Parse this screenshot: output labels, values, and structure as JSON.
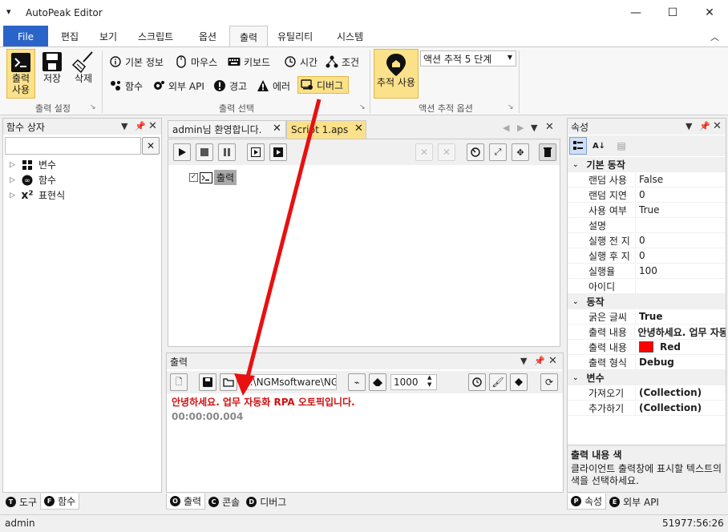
{
  "window": {
    "title": "AutoPeak Editor",
    "status_left": "admin",
    "status_right": "51977:56:26"
  },
  "menu_tabs": [
    "File",
    "편집",
    "보기",
    "스크립트",
    "옵션",
    "출력",
    "유틸리티",
    "시스템"
  ],
  "ribbon": {
    "output_group": {
      "btn_output": "출력\n사용",
      "btn_save": "저장",
      "btn_delete": "삭제",
      "label": "출력 설정"
    },
    "select_group": {
      "items": [
        "기본 정보",
        "마우스",
        "키보드",
        "시간",
        "조건",
        "함수",
        "외부 API",
        "경고",
        "에러",
        "디버그"
      ],
      "label": "출력 선택"
    },
    "trace_group": {
      "btn_trace": "추적 사용",
      "dropdown": "액션 추적 5 단계",
      "label": "액션 추적 옵션"
    }
  },
  "left_panel": {
    "title": "함수 상자",
    "tree": [
      "변수",
      "함수",
      "표현식"
    ],
    "bottom_tabs": [
      {
        "key": "T",
        "label": "도구"
      },
      {
        "key": "F",
        "label": "함수"
      }
    ]
  },
  "doc_tabs": [
    "admin님 환영합니다.",
    "Script 1.aps"
  ],
  "script_tree": {
    "node": "출력"
  },
  "output_panel": {
    "title": "출력",
    "path": "E:\\NGMsoftware\\NG",
    "count": "1000",
    "message": "안녕하세요. 업무 자동화 RPA 오토픽입니다.",
    "time": "00:00:00.004",
    "bottom_tabs": [
      {
        "key": "O",
        "label": "출력"
      },
      {
        "key": "C",
        "label": "콘솔"
      },
      {
        "key": "D",
        "label": "디버그"
      }
    ]
  },
  "props_panel": {
    "title": "속성",
    "categories": [
      {
        "name": "기본 동작",
        "rows": [
          [
            "랜덤 사용",
            "False"
          ],
          [
            "랜덤 지연",
            "0"
          ],
          [
            "사용 여부",
            "True"
          ],
          [
            "설명",
            ""
          ],
          [
            "실행 전 지",
            "0"
          ],
          [
            "실행 후 지",
            "0"
          ],
          [
            "실행율",
            "100"
          ],
          [
            "아이디",
            ""
          ]
        ]
      },
      {
        "name": "동작",
        "rows": [
          [
            "굵은 글씨",
            "True"
          ],
          [
            "출력 내용",
            "안녕하세요. 업무 자동"
          ],
          [
            "출력 내용",
            "Red"
          ],
          [
            "출력 형식",
            "Debug"
          ]
        ]
      },
      {
        "name": "변수",
        "rows": [
          [
            "가져오기",
            "(Collection)"
          ],
          [
            "추가하기",
            "(Collection)"
          ]
        ]
      }
    ],
    "desc_title": "출력 내용 색",
    "desc_text": "클라이언트 출력창에 표시할 텍스트의 색을 선택하세요.",
    "bottom_tabs": [
      {
        "key": "P",
        "label": "속성"
      },
      {
        "key": "E",
        "label": "외부 API"
      }
    ]
  },
  "colors": {
    "accent": "#2b64c8",
    "highlight": "#fbe18a",
    "message_red": "#d01010",
    "arrow": "#e81010"
  }
}
